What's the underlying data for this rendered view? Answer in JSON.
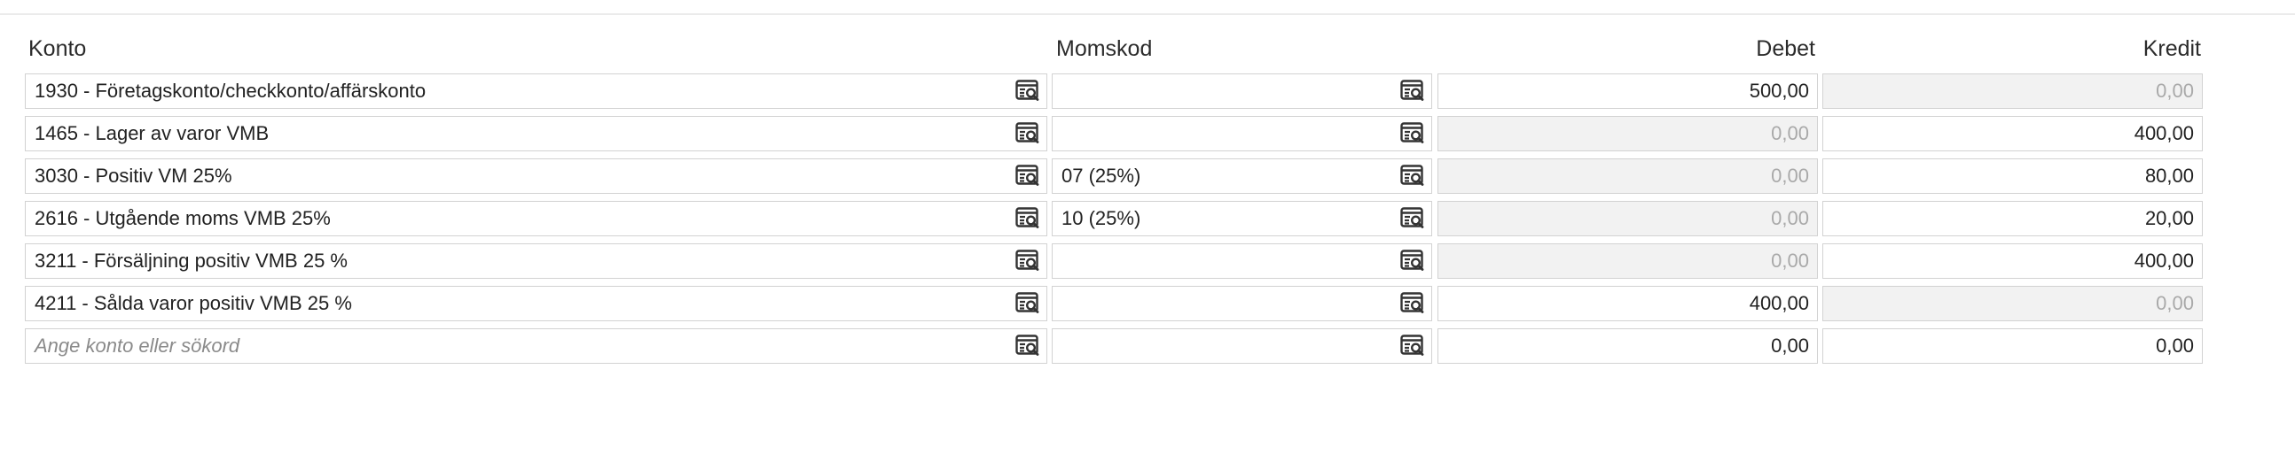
{
  "headers": {
    "konto": "Konto",
    "momskod": "Momskod",
    "debet": "Debet",
    "kredit": "Kredit"
  },
  "icons": {
    "lookup": "list-search-icon"
  },
  "rows": [
    {
      "konto": "1930 - Företagskonto/checkkonto/affärskonto",
      "momskod": "",
      "debet": "500,00",
      "kredit": "0,00"
    },
    {
      "konto": "1465 - Lager av varor VMB",
      "momskod": "",
      "debet": "0,00",
      "kredit": "400,00"
    },
    {
      "konto": "3030 - Positiv VM 25%",
      "momskod": "07 (25%)",
      "debet": "0,00",
      "kredit": "80,00"
    },
    {
      "konto": "2616 - Utgående moms VMB 25%",
      "momskod": "10 (25%)",
      "debet": "0,00",
      "kredit": "20,00"
    },
    {
      "konto": "3211 - Försäljning positiv VMB 25 %",
      "momskod": "",
      "debet": "0,00",
      "kredit": "400,00"
    },
    {
      "konto": "4211 - Sålda varor positiv VMB 25 %",
      "momskod": "",
      "debet": "400,00",
      "kredit": "0,00"
    }
  ],
  "new_row": {
    "konto_placeholder": "Ange konto eller sökord",
    "momskod": "",
    "debet": "0,00",
    "kredit": "0,00"
  }
}
